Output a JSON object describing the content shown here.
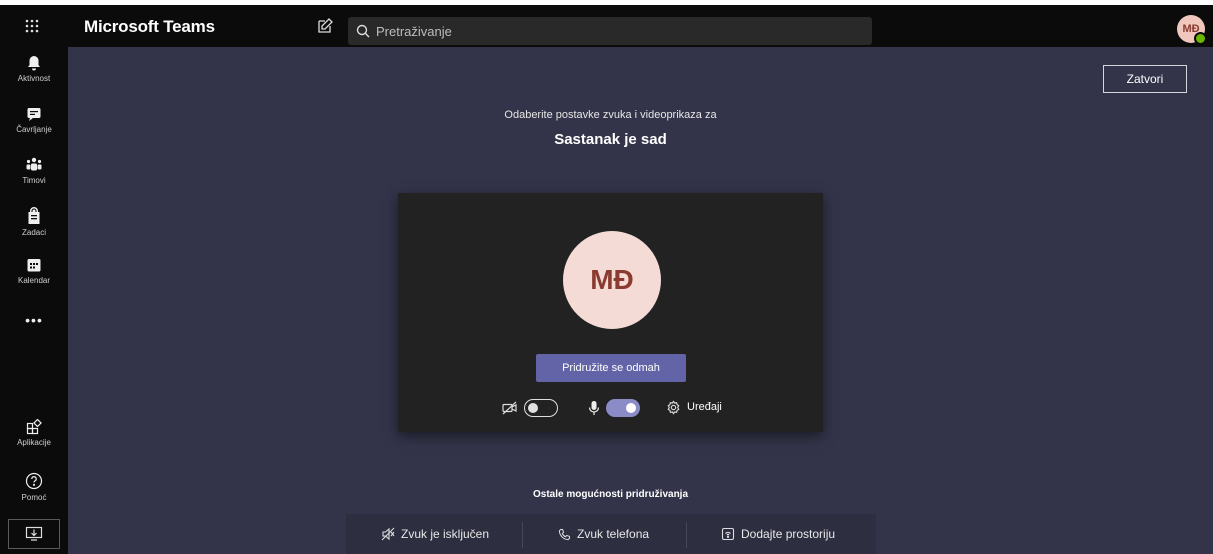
{
  "app": {
    "title": "Microsoft Teams"
  },
  "search": {
    "placeholder": "Pretraživanje"
  },
  "user": {
    "initials": "MĐ",
    "status_color": "#6bb700"
  },
  "rail": {
    "items": [
      {
        "label": "Aktivnost",
        "icon": "bell-icon"
      },
      {
        "label": "Čavrljanje",
        "icon": "chat-icon"
      },
      {
        "label": "Timovi",
        "icon": "teams-icon"
      },
      {
        "label": "Zadaci",
        "icon": "assignments-icon"
      },
      {
        "label": "Kalendar",
        "icon": "calendar-icon"
      }
    ],
    "more": "•••",
    "apps": {
      "label": "Aplikacije",
      "icon": "apps-icon"
    },
    "help": {
      "label": "Pomoć",
      "icon": "help-icon"
    }
  },
  "prejoin": {
    "close_label": "Zatvori",
    "subtitle": "Odaberite postavke zvuka i videoprikaza za",
    "meeting_title": "Sastanak je sad",
    "avatar_initials": "MĐ",
    "join_label": "Pridružite se odmah",
    "camera_on": false,
    "mic_on": true,
    "devices_label": "Uređaji"
  },
  "other_options": {
    "title": "Ostale mogućnosti pridruživanja",
    "items": [
      {
        "label": "Zvuk je isključen",
        "icon": "speaker-off-icon"
      },
      {
        "label": "Zvuk telefona",
        "icon": "phone-icon"
      },
      {
        "label": "Dodajte prostoriju",
        "icon": "cast-icon"
      }
    ]
  },
  "colors": {
    "accent": "#6264a7",
    "toggle_on": "#8b8cc7",
    "stage": "#33344a",
    "avatar_bg": "#f4dbd5"
  }
}
